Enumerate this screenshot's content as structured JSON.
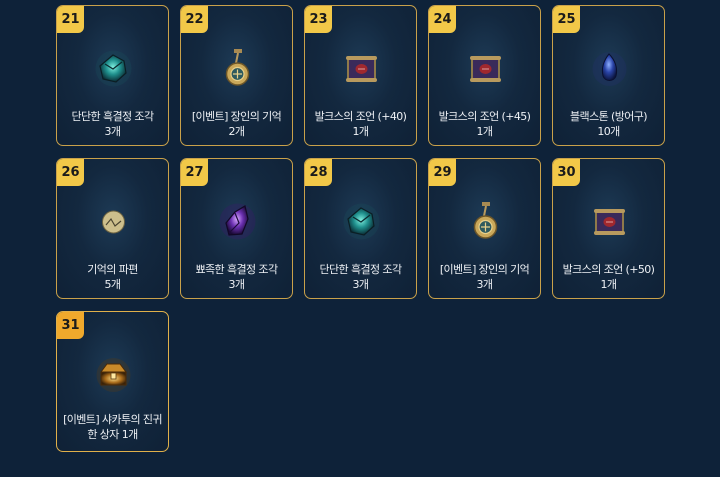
{
  "items": [
    {
      "number": "21",
      "name": "단단한 흑결정 조각",
      "qty": "3개",
      "icon": "crystal-teal-icon"
    },
    {
      "number": "22",
      "name": "[이벤트] 장인의 기억",
      "qty": "2개",
      "icon": "pendant-icon"
    },
    {
      "number": "23",
      "name": "발크스의 조언 (+40)",
      "qty": "1개",
      "icon": "scroll-icon"
    },
    {
      "number": "24",
      "name": "발크스의 조언 (+45)",
      "qty": "1개",
      "icon": "scroll-icon"
    },
    {
      "number": "25",
      "name": "블랙스톤 (방어구)",
      "qty": "10개",
      "icon": "blackstone-armor-icon"
    },
    {
      "number": "26",
      "name": "기억의 파편",
      "qty": "5개",
      "icon": "memory-fragment-icon"
    },
    {
      "number": "27",
      "name": "뾰족한 흑결정 조각",
      "qty": "3개",
      "icon": "crystal-purple-icon"
    },
    {
      "number": "28",
      "name": "단단한 흑결정 조각",
      "qty": "3개",
      "icon": "crystal-teal-icon"
    },
    {
      "number": "29",
      "name": "[이벤트] 장인의 기억",
      "qty": "3개",
      "icon": "pendant-icon"
    },
    {
      "number": "30",
      "name": "발크스의 조언 (+50)",
      "qty": "1개",
      "icon": "scroll-icon"
    },
    {
      "number": "31",
      "name": "[이벤트] 샤카투의 진귀한 상자",
      "qty": "1개",
      "icon": "treasure-chest-icon"
    }
  ]
}
